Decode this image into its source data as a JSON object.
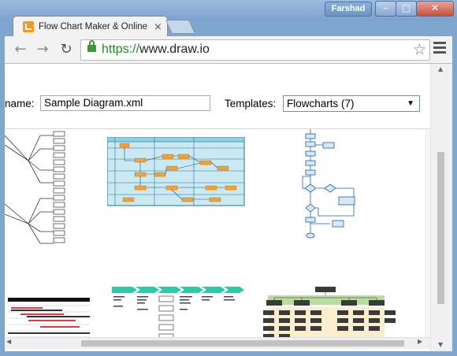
{
  "window": {
    "user_badge": "Farshad",
    "minimize_glyph": "–",
    "maximize_glyph": "□",
    "close_glyph": "✕"
  },
  "tab": {
    "title": "Flow Chart Maker & Online Diagram Software",
    "close_glyph": "×",
    "favicon": "drawio-icon"
  },
  "toolbar": {
    "back_glyph": "←",
    "forward_glyph": "→",
    "reload_glyph": "↻",
    "url_scheme": "https://",
    "url_host": "www.draw.io",
    "star_glyph": "☆"
  },
  "dialog": {
    "name_label": "name:",
    "name_value": "Sample Diagram.xml",
    "templates_label": "Templates:",
    "templates_selected": "Flowcharts (7)",
    "dropdown_glyph": "▼"
  },
  "gallery": {
    "thumbnails": [
      "tree-diagram",
      "swimlane-flowchart",
      "vertical-flowchart",
      "gantt-chart",
      "process-steps",
      "org-chart"
    ]
  },
  "colors": {
    "accent_blue": "#1f5fa8",
    "swimlane_fill": "#cbe9f1",
    "box_orange": "#f2a23a",
    "green_step": "#2fc9a7",
    "drawio_orange": "#f29a1d"
  }
}
